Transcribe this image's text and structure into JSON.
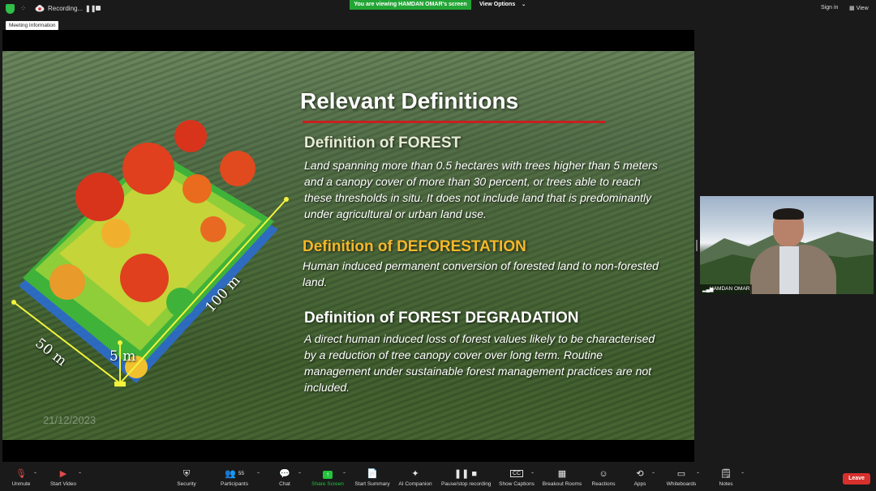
{
  "top_bar": {
    "recording_label": "Recording...",
    "viewing_banner": "You are viewing HAMDAN OMAR's screen",
    "view_options_label": "View Options",
    "sign_in_label": "Sign in",
    "view_label": "View"
  },
  "meeting_info_label": "Meeting Information",
  "slide": {
    "title": "Relevant Definitions",
    "forest_heading": "Definition of FOREST",
    "forest_text": "Land spanning more than 0.5 hectares with trees higher than 5 meters and a canopy cover of more than 30 percent, or trees able to reach these thresholds in situ. It does not include land that is predominantly under agricultural or urban land use.",
    "deforestation_heading": "Definition of DEFORESTATION",
    "deforestation_text": "Human induced permanent conversion of forested land to non-forested land.",
    "degradation_heading": "Definition of FOREST DEGRADATION",
    "degradation_text": "A direct human induced loss of forest values likely to be characterised by a reduction of tree canopy cover over long term. Routine management under sustainable forest management practices are not included.",
    "dim_100": "100 m",
    "dim_50": "50 m",
    "dim_5": "5 m",
    "date_watermark": "21/12/2023"
  },
  "participant_video": {
    "name": "HAMDAN OMAR"
  },
  "toolbar": {
    "unmute": "Unmute",
    "start_video": "Start Video",
    "security": "Security",
    "participants": "Participants",
    "participant_count": "55",
    "chat": "Chat",
    "share_screen": "Share Screen",
    "start_summary": "Start Summary",
    "ai_companion": "AI Companion",
    "pause_stop": "Pause/stop recording",
    "show_captions": "Show Captions",
    "breakout_rooms": "Breakout Rooms",
    "reactions": "Reactions",
    "apps": "Apps",
    "whiteboards": "Whiteboards",
    "notes": "Notes",
    "leave": "Leave"
  },
  "colors": {
    "zoom_green": "#23a536",
    "leave_red": "#d8302d",
    "title_rule_red": "#c82020",
    "deforestation_orange": "#f5b82a"
  }
}
